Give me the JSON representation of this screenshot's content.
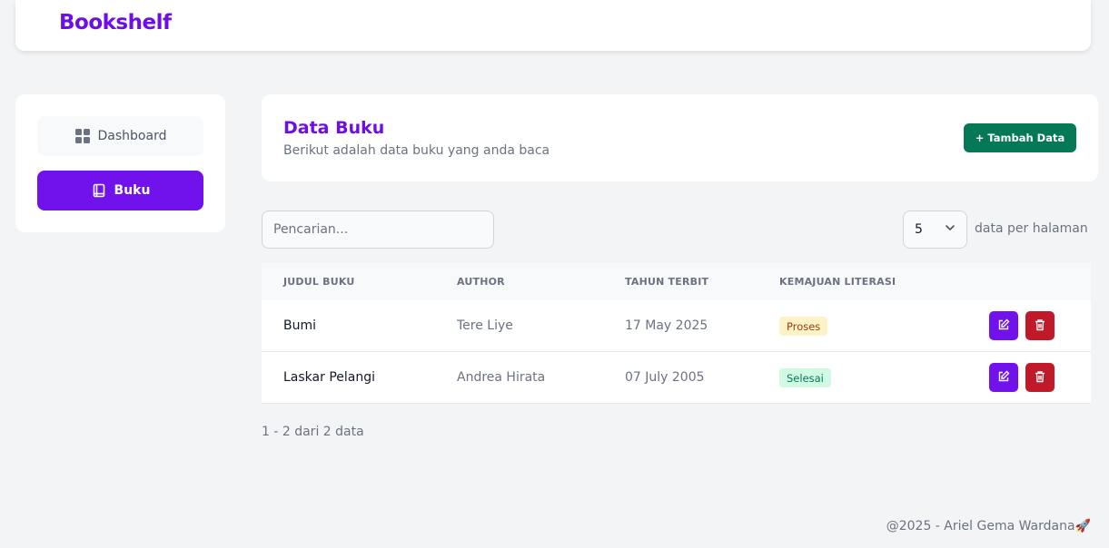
{
  "app": {
    "brand": "Bookshelf"
  },
  "sidebar": {
    "items": [
      {
        "label": "Dashboard",
        "icon": "grid-icon",
        "active": false
      },
      {
        "label": "Buku",
        "icon": "book-icon",
        "active": true
      }
    ]
  },
  "header": {
    "title": "Data Buku",
    "subtitle": "Berikut adalah data buku yang anda baca",
    "add_button": "+ Tambah Data"
  },
  "search": {
    "placeholder": "Pencarian...",
    "value": ""
  },
  "per_page": {
    "value": "5",
    "label": "data per halaman"
  },
  "table": {
    "columns": [
      "JUDUL BUKU",
      "AUTHOR",
      "TAHUN TERBIT",
      "KEMAJUAN LITERASI"
    ],
    "rows": [
      {
        "title": "Bumi",
        "author": "Tere Liye",
        "date": "17 May 2025",
        "status": "Proses"
      },
      {
        "title": "Laskar Pelangi",
        "author": "Andrea Hirata",
        "date": "07 July 2005",
        "status": "Selesai"
      }
    ]
  },
  "pagination": {
    "info": "1 - 2 dari 2 data"
  },
  "footer": {
    "text": "@2025 - Ariel Gema Wardana🚀"
  },
  "colors": {
    "brand": "#6d0ee6",
    "primary_button": "#7112ec",
    "add_button": "#047857",
    "delete_button": "#c0192a",
    "badge_proses_bg": "#fef3c7",
    "badge_selesai_bg": "#d1fae5"
  }
}
